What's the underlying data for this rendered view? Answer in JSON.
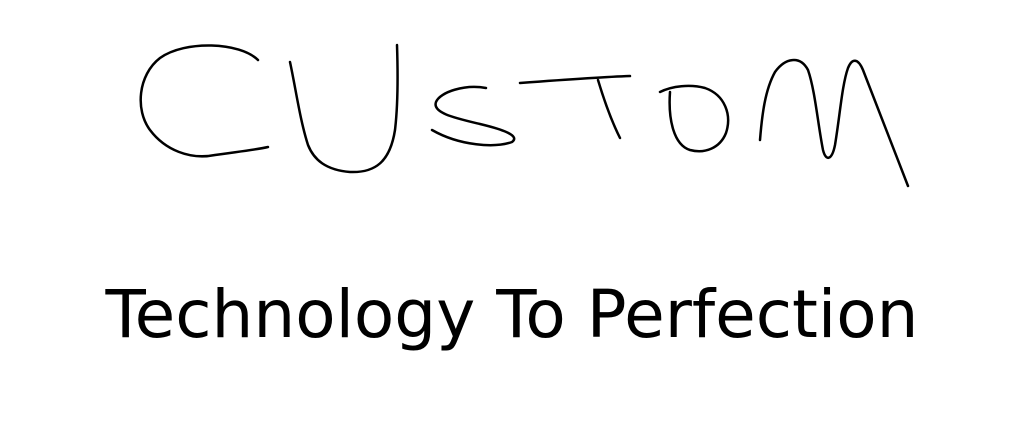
{
  "logo": {
    "handwritten_text": "CUSTOM",
    "stroke_color": "#000000"
  },
  "tagline": "Technology To Perfection"
}
